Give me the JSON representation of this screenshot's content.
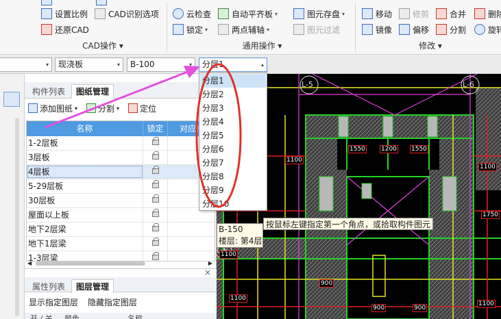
{
  "ribbon": {
    "cad": {
      "items": [
        "设置比例",
        "还原CAD",
        "CAD识别选项"
      ],
      "group_label": "CAD操作"
    },
    "general": {
      "items": [
        "云检查",
        "锁定",
        "自动平齐板",
        "两点辅轴",
        "图元存盘",
        "图元过滤"
      ],
      "group_label": "通用操作"
    },
    "modify": {
      "items": [
        "移动",
        "修剪",
        "合并",
        "删除",
        "镜像",
        "偏移",
        "分割",
        "旋转"
      ],
      "group_label": "修改"
    }
  },
  "propbar": {
    "combo1": "",
    "combo2": "现浇板",
    "combo3": "B-100",
    "combo4": "分层1"
  },
  "dropdown": {
    "options": [
      "分层1",
      "分层2",
      "分层3",
      "分层4",
      "分层5",
      "分层6",
      "分层7",
      "分层8",
      "分层9",
      "分层10"
    ],
    "selected_index": 0
  },
  "panel": {
    "tabs": [
      "构件列表",
      "图纸管理"
    ],
    "active_tab": 1,
    "toolbar": {
      "add": "添加图纸",
      "split": "分割",
      "locate": "定位"
    },
    "columns": [
      "名称",
      "锁定",
      "对应楼"
    ],
    "rows": [
      "1-2层板",
      "3层板",
      "4层板",
      "5-29层板",
      "30层板",
      "屋面以上板",
      "地下2层梁",
      "地下1层梁",
      "1-3层梁"
    ],
    "selected_row": 2
  },
  "panel2": {
    "tabs": [
      "属性列表",
      "图层管理"
    ],
    "active_tab": 1,
    "show_label": "显示指定图层",
    "hide_label": "隐藏指定图层",
    "columns": [
      "开 / 关",
      "颜色",
      "名称"
    ],
    "close_glyph": "×"
  },
  "canvas": {
    "axis_labels": [
      "L-5",
      "L-6",
      "L-E"
    ],
    "dims": [
      "1100",
      "1550",
      "1200",
      "1550",
      "1100",
      "900",
      "900",
      "1100",
      "900",
      "1100",
      "1750",
      "1100"
    ]
  },
  "tooltip": {
    "line1": "B-150",
    "line2": "楼层: 第4层",
    "hint": "按鼠标左键指定第一个角点，或拾取构件图元"
  },
  "colors": {
    "accent_blue": "#4f9ae0",
    "annotation_red": "#e0312b",
    "arrow_magenta": "#e64fe0",
    "cad_green": "#26d226",
    "cad_yellow": "#e6e626",
    "cad_red": "#e02020",
    "cad_magenta": "#e040e0"
  }
}
